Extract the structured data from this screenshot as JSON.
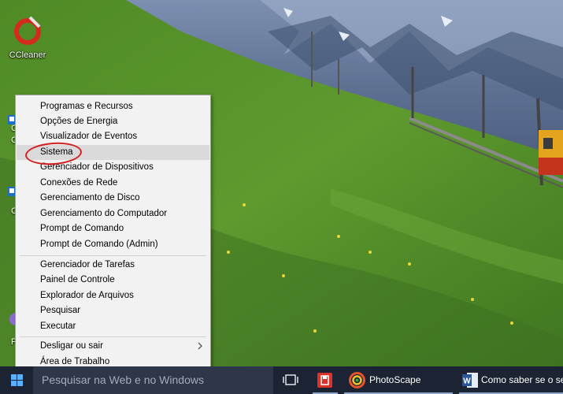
{
  "desktop": {
    "icons": [
      {
        "label": "CCleaner",
        "icon": "ccleaner-icon"
      }
    ],
    "partial_letters": [
      "C",
      "C",
      "C",
      "P"
    ]
  },
  "context_menu": {
    "groups": [
      [
        "Programas e Recursos",
        "Opções de Energia",
        "Visualizador de Eventos",
        "Sistema",
        "Gerenciador de Dispositivos",
        "Conexões de Rede",
        "Gerenciamento de Disco",
        "Gerenciamento do Computador",
        "Prompt de Comando",
        "Prompt de Comando (Admin)"
      ],
      [
        "Gerenciador de Tarefas",
        "Painel de Controle",
        "Explorador de Arquivos",
        "Pesquisar",
        "Executar"
      ],
      [
        "Desligar ou sair",
        "Área de Trabalho"
      ]
    ],
    "highlighted_item": "Sistema",
    "submenu_item": "Desligar ou sair",
    "submenu_arrow_icon": "chevron-right-icon",
    "annotation_color": "#d42020"
  },
  "taskbar": {
    "search_placeholder": "Pesquisar na Web e no Windows",
    "start_icon": "windows-logo-icon",
    "task_view_icon": "task-view-icon",
    "apps": [
      {
        "label": "",
        "icon": "red-app-icon"
      },
      {
        "label": "PhotoScape",
        "icon": "photoscape-icon"
      },
      {
        "label": "Como saber se o se...",
        "icon": "word-icon"
      }
    ],
    "background_color": "#1c2434",
    "active_underline_color": "#8ea7d1"
  }
}
